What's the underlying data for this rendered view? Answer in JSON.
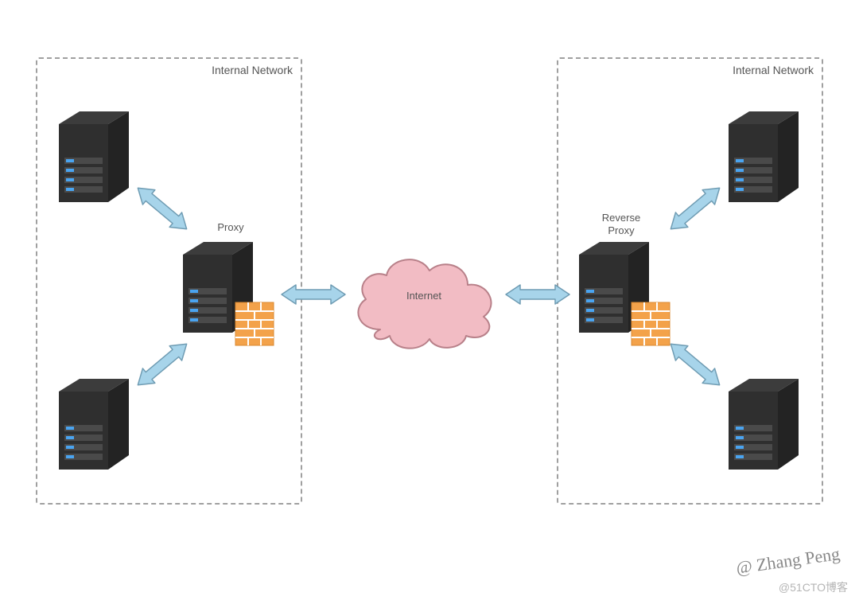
{
  "diagram": {
    "left_network": {
      "title": "Internal Network"
    },
    "right_network": {
      "title": "Internal Network"
    },
    "proxy": {
      "label": "Proxy"
    },
    "reverse_proxy": {
      "label_line1": "Reverse",
      "label_line2": "Proxy"
    },
    "internet": {
      "label": "Internet"
    }
  },
  "watermark": {
    "script": "@ Zhang Peng",
    "text": "@51CTO博客"
  },
  "colors": {
    "arrow_fill": "#a7d4ea",
    "arrow_stroke": "#6f9cb3",
    "cloud_fill": "#f2bcc4",
    "cloud_stroke": "#b88089",
    "server_body": "#2f2f2f",
    "server_bay": "#474747",
    "server_light": "#4aa4f0",
    "firewall_fill": "#f3a24a",
    "firewall_mortar": "#ffffff"
  }
}
